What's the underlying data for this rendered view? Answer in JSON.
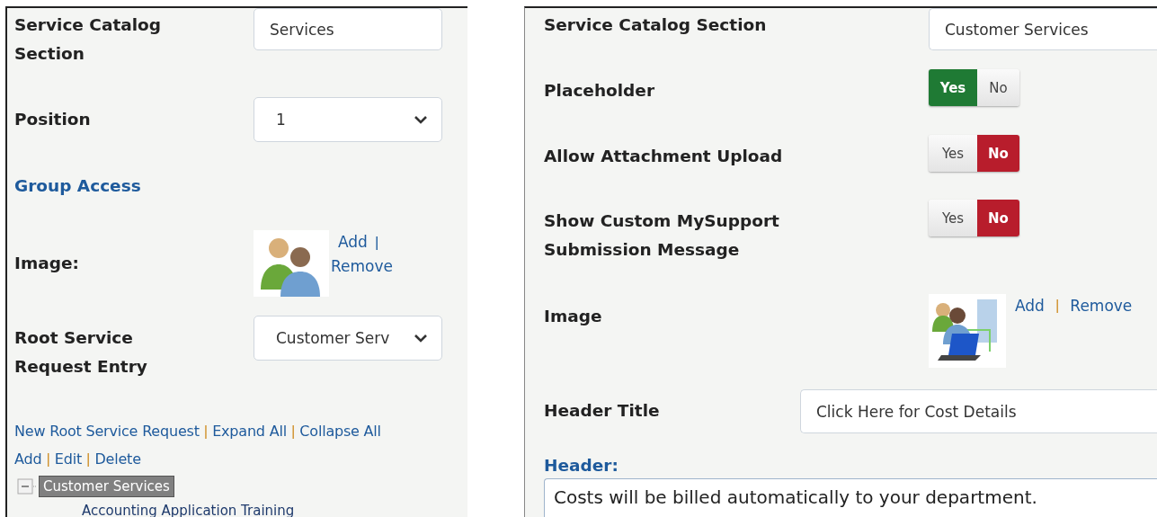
{
  "left_panel": {
    "fields": [
      {
        "kind": "text",
        "label": "Service Catalog Section",
        "value": "Services"
      },
      {
        "kind": "select",
        "label": "Position",
        "value": "1"
      },
      {
        "kind": "link",
        "label": "Group Access"
      },
      {
        "kind": "image",
        "label": "Image:",
        "actions": [
          "Add",
          "Remove"
        ],
        "separator": "|"
      },
      {
        "kind": "select",
        "label": "Root Service Request Entry",
        "value": "Customer Serv"
      }
    ],
    "tree_actions": [
      {
        "links": [
          "New Root Service Request",
          "Expand All",
          "Collapse All"
        ],
        "separator": "|"
      },
      {
        "links": [
          "Add",
          "Edit",
          "Delete"
        ],
        "separator": "|"
      }
    ],
    "tree": [
      {
        "label": "Customer Services",
        "selected": true,
        "expanded": true,
        "children": [
          {
            "label": "Accounting Application Training",
            "selected": false
          }
        ]
      }
    ]
  },
  "right_panel": {
    "fields": [
      {
        "kind": "text",
        "label": "Service Catalog Section",
        "value": "Customer Services"
      },
      {
        "kind": "toggle",
        "label": "Placeholder",
        "options": [
          {
            "label": "Yes",
            "selected": true
          },
          {
            "label": "No",
            "selected": false
          }
        ]
      },
      {
        "kind": "toggle",
        "label": "Allow Attachment Upload",
        "options": [
          {
            "label": "Yes",
            "selected": false
          },
          {
            "label": "No",
            "selected": true
          }
        ]
      },
      {
        "kind": "toggle",
        "label": "Show Custom MySupport Submission Message",
        "options": [
          {
            "label": "Yes",
            "selected": false
          },
          {
            "label": "No",
            "selected": true
          }
        ]
      },
      {
        "kind": "image",
        "label": "Image",
        "actions": [
          "Add",
          "Remove"
        ],
        "separator": "|"
      },
      {
        "kind": "wide_text",
        "label": "Header Title",
        "value": "Click Here for Cost Details"
      },
      {
        "kind": "editor",
        "label": "Header:",
        "value": "Costs will be billed automatically to your department."
      }
    ]
  }
}
